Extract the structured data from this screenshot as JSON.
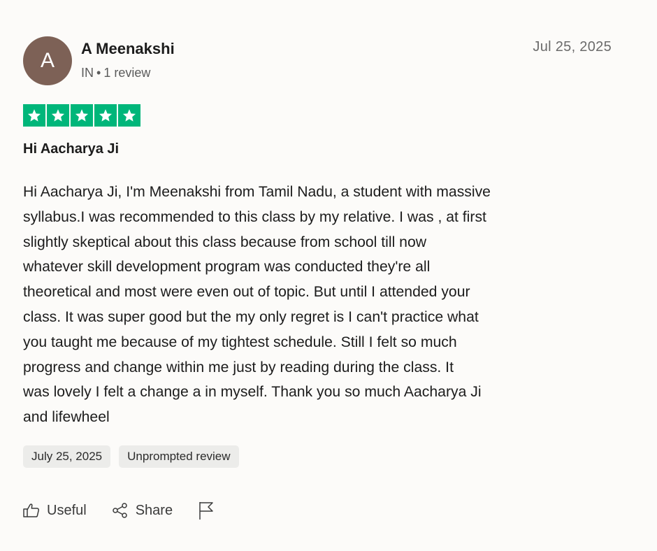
{
  "review": {
    "avatar_initial": "A",
    "author_name": "A Meenakshi",
    "author_country": "IN",
    "author_separator": "•",
    "author_reviews": "1 review",
    "date": "Jul 25, 2025",
    "rating": 5,
    "rating_color": "#00b67a",
    "title": "Hi Aacharya Ji",
    "body_lines": [
      "Hi Aacharya Ji, I'm Meenakshi from Tamil Nadu, a student with massive",
      "syllabus.I was recommended to this class by my relative. I was , at first",
      "slightly skeptical about this class because from school till now",
      "whatever skill development program was conducted they're all",
      "theoretical and most were even out of topic. But until I attended your",
      "class. It was super good but the my only regret is I can't practice what",
      "you taught me because of my tightest schedule. Still I felt so much",
      "progress and change within me just by reading during the class. It",
      "was lovely I felt a change a in myself. Thank you so much Aacharya Ji",
      "and lifewheel"
    ],
    "tags": [
      "July 25, 2025",
      "Unprompted review"
    ]
  },
  "actions": {
    "useful_label": "Useful",
    "useful_icon": "thumbs-up-icon",
    "share_label": "Share",
    "share_icon": "share-icon",
    "report_icon": "flag-icon"
  }
}
